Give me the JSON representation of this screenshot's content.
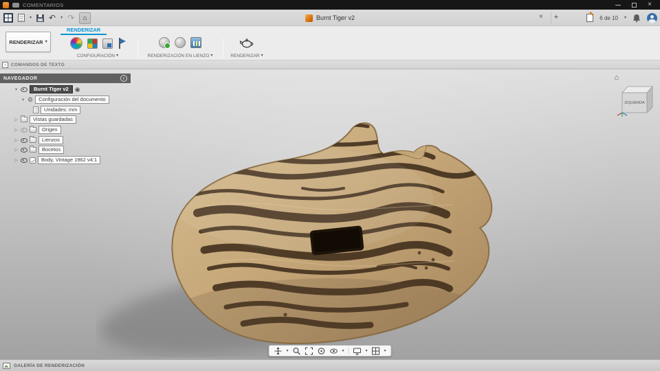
{
  "icons": {
    "caret": "▾",
    "disclosure": "▷",
    "expanded": "▾",
    "undo": "↶",
    "redo": "↷",
    "home": "⌂",
    "plus": "+",
    "close_tab": "×",
    "close_window": "×",
    "gear": "⚙",
    "activate": "◉",
    "collapse_left": "‹",
    "prompt": "›"
  },
  "comments_bar": {
    "title": "COMENTARIOS"
  },
  "toolbar": {
    "doc_title": "Burnt Tiger v2",
    "job_status": "6 de 10"
  },
  "ribbon": {
    "workspace": "RENDERIZAR",
    "active_tab": "RENDERIZAR",
    "groups": [
      {
        "label": "CONFIGURACIÓN"
      },
      {
        "label": "RENDERIZACIÓN EN LIENZO"
      },
      {
        "label": "RENDERIZAR"
      }
    ]
  },
  "text_commands": {
    "label": "COMANDOS DE TEXTO"
  },
  "navigator": {
    "title": "NAVEGADOR",
    "root_label": "Burnt Tiger v2",
    "items": [
      {
        "label": "Configuración del documento"
      },
      {
        "label": "Unidades: mm"
      },
      {
        "label": "Vistas guardadas"
      },
      {
        "label": "Origen"
      },
      {
        "label": "Lienzos"
      },
      {
        "label": "Bocetos"
      },
      {
        "label": "Body, Vintage 1962 v4:1"
      }
    ]
  },
  "viewcube": {
    "front_face": "IZQUIERDA"
  },
  "footer": {
    "label": "GALERÍA DE RENDERIZACIÓN"
  }
}
